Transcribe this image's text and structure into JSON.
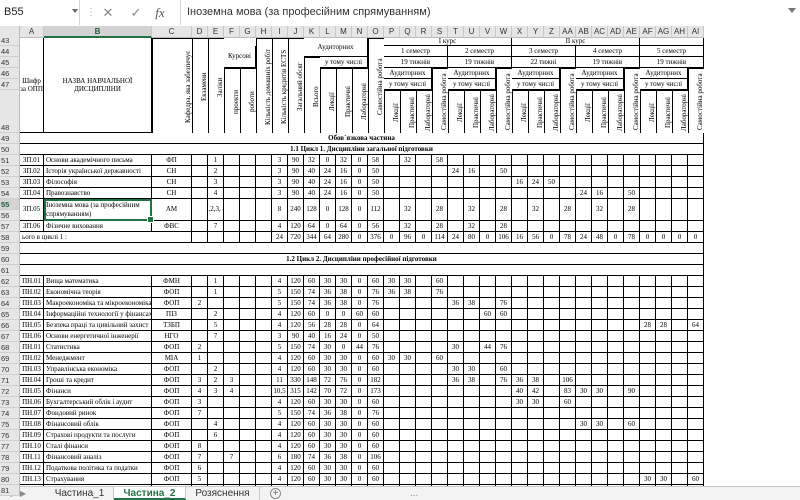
{
  "formula_bar": {
    "name_box": "B55",
    "cancel_icon": "close-icon",
    "confirm_icon": "check-icon",
    "fx_label": "fx",
    "content": "Іноземна мова (за професійним спрямуванням)"
  },
  "columns": [
    "A",
    "B",
    "C",
    "D",
    "E",
    "F",
    "G",
    "H",
    "I",
    "J",
    "K",
    "L",
    "M",
    "N",
    "O",
    "P",
    "Q",
    "R",
    "S",
    "T",
    "U",
    "V",
    "W",
    "X",
    "Y",
    "Z",
    "AA",
    "AB",
    "AC",
    "AD",
    "AE",
    "AF",
    "AG",
    "AH",
    "AI"
  ],
  "selected_column": "B",
  "header_rows": [
    "43",
    "44",
    "45",
    "46",
    "47",
    "48"
  ],
  "rows": [
    "49",
    "50",
    "51",
    "52",
    "53",
    "54",
    "55",
    "56",
    "57",
    "58",
    "59",
    "60",
    "61",
    "62",
    "63",
    "64",
    "65",
    "66",
    "67",
    "68",
    "69",
    "70",
    "71",
    "72",
    "73",
    "74",
    "75",
    "76",
    "77",
    "78",
    "79",
    "80",
    "81",
    "82",
    "83",
    "84",
    "85"
  ],
  "selected_row": "55",
  "table_header": {
    "code": "Шифр за ОПП",
    "name": "НАЗВА НАВЧАЛЬНОЇ ДИСЦИПЛІНИ",
    "dept": "Кафедра, яка забезпечує",
    "exams": "Екзамени",
    "credits_pass": "Заліки",
    "course_group": "Курсові",
    "projects": "проекти",
    "works": "роботи",
    "ind_works": "Кількість домашніх робіт",
    "ects": "Кількість кредитів ECTS",
    "total": "Загальний обсяг",
    "class_group": "Аудиторних",
    "incl": "у тому числі",
    "all": "Всього",
    "lect": "Лекції",
    "pract": "Практичні",
    "lab": "Лабораторні",
    "self": "Самостійна робота",
    "course1": "І курс",
    "course2": "ІІ курс",
    "sem1": "1 семестр",
    "sem2": "2 семестр",
    "sem3": "3 семестр",
    "sem4": "4 семестр",
    "sem5": "5 семестр",
    "weeks19": "19 тижнів",
    "weeks22": "22 тижні",
    "aud": "Аудиторних",
    "incl2": "у тому числі"
  },
  "sections": {
    "obligatory": "Обов`язкова частина",
    "cycle1": "1.1 Цикл 1. Дисципліни загальної підготовки",
    "cycle2": "1.2 Цикл 2. Дисципліни професійної підготовки"
  },
  "cycle1_rows": [
    {
      "code": "ЗП.01",
      "name": "Основи академічного письма",
      "dept": "ФП",
      "d": "",
      "e": "1",
      "f": "",
      "g": "",
      "h": "",
      "i": "3",
      "j": "90",
      "k": "32",
      "l": "0",
      "m": "32",
      "n": "0",
      "o": "58",
      "p": "",
      "q": "32",
      "r": "",
      "s": "58",
      "t": "",
      "u": "",
      "v": "",
      "w": "",
      "x": "",
      "y": "",
      "z": "",
      "aa": "",
      "ab": "",
      "ac": "",
      "ad": "",
      "ae": "",
      "af": "",
      "ag": "",
      "ah": "",
      "ai": ""
    },
    {
      "code": "ЗП.02",
      "name": "Історія української державності",
      "dept": "СН",
      "d": "",
      "e": "2",
      "f": "",
      "g": "",
      "h": "",
      "i": "3",
      "j": "90",
      "k": "40",
      "l": "24",
      "m": "16",
      "n": "0",
      "o": "50",
      "p": "",
      "q": "",
      "r": "",
      "s": "",
      "t": "24",
      "u": "16",
      "v": "",
      "w": "50",
      "x": "",
      "y": "",
      "z": "",
      "aa": "",
      "ab": "",
      "ac": "",
      "ad": "",
      "ae": "",
      "af": "",
      "ag": "",
      "ah": "",
      "ai": ""
    },
    {
      "code": "ЗП.03",
      "name": "Філософія",
      "dept": "СН",
      "d": "",
      "e": "3",
      "f": "",
      "g": "",
      "h": "",
      "i": "3",
      "j": "90",
      "k": "40",
      "l": "24",
      "m": "16",
      "n": "0",
      "o": "50",
      "p": "",
      "q": "",
      "r": "",
      "s": "",
      "t": "",
      "u": "",
      "v": "",
      "w": "",
      "x": "16",
      "y": "24",
      "z": "50",
      "aa": "",
      "ab": "",
      "ac": "",
      "ad": "",
      "ae": "",
      "af": "",
      "ag": "",
      "ah": "",
      "ai": ""
    },
    {
      "code": "ЗП.04",
      "name": "Правознавство",
      "dept": "СН",
      "d": "",
      "e": "4",
      "f": "",
      "g": "",
      "h": "",
      "i": "3",
      "j": "90",
      "k": "40",
      "l": "24",
      "m": "16",
      "n": "0",
      "o": "50",
      "p": "",
      "q": "",
      "r": "",
      "s": "",
      "t": "",
      "u": "",
      "v": "",
      "w": "",
      "x": "",
      "y": "",
      "z": "",
      "aa": "",
      "ab": "24",
      "ac": "16",
      "ad": "",
      "ae": "50",
      "af": "",
      "ag": "",
      "ah": "",
      "ai": ""
    },
    {
      "code": "ЗП.05",
      "name": "Іноземна мова (за професійним спрямуванням)",
      "dept": "АМ",
      "d": "",
      "e": "1,2,3,\n4",
      "f": "",
      "g": "",
      "h": "",
      "i": "8",
      "j": "240",
      "k": "128",
      "l": "0",
      "m": "128",
      "n": "0",
      "o": "112",
      "p": "",
      "q": "32",
      "r": "",
      "s": "28",
      "t": "",
      "u": "32",
      "v": "",
      "w": "28",
      "x": "",
      "y": "32",
      "z": "",
      "aa": "28",
      "ab": "",
      "ac": "32",
      "ad": "",
      "ae": "28",
      "af": "",
      "ag": "",
      "ah": "",
      "ai": ""
    },
    {
      "code": "ЗП.06",
      "name": "Фізичне виховання",
      "dept": "ФВС",
      "d": "",
      "e": "7",
      "f": "",
      "g": "",
      "h": "",
      "i": "4",
      "j": "120",
      "k": "64",
      "l": "0",
      "m": "64",
      "n": "0",
      "o": "56",
      "p": "",
      "q": "32",
      "r": "",
      "s": "28",
      "t": "",
      "u": "32",
      "v": "",
      "w": "28",
      "x": "",
      "y": "",
      "z": "",
      "aa": "",
      "ab": "",
      "ac": "",
      "ad": "",
      "ae": "",
      "af": "",
      "ag": "",
      "ah": "",
      "ai": ""
    }
  ],
  "cycle1_total": {
    "label": "ього в циклі 1 :",
    "i": "24",
    "j": "720",
    "k": "344",
    "l": "64",
    "m": "280",
    "n": "0",
    "o": "376",
    "p": "0",
    "q": "96",
    "r": "0",
    "s": "114",
    "t": "24",
    "u": "80",
    "v": "0",
    "w": "106",
    "x": "16",
    "y": "56",
    "z": "0",
    "aa": "78",
    "ab": "24",
    "ac": "48",
    "ad": "0",
    "ae": "78",
    "af": "0",
    "ag": "0",
    "ah": "0",
    "ai": "0"
  },
  "cycle2_rows": [
    {
      "code": "ПН.01",
      "name": "Вища математика",
      "dept": "ФМН",
      "d": "",
      "e": "1",
      "f": "",
      "g": "",
      "h": "",
      "i": "4",
      "j": "120",
      "k": "60",
      "l": "30",
      "m": "30",
      "n": "0",
      "o": "60",
      "p": "30",
      "q": "30",
      "r": "",
      "s": "60",
      "t": "",
      "u": "",
      "v": "",
      "w": "",
      "x": "",
      "y": "",
      "z": "",
      "aa": "",
      "ab": "",
      "ac": "",
      "ad": "",
      "ae": "",
      "af": "",
      "ag": "",
      "ah": "",
      "ai": ""
    },
    {
      "code": "ПН.02",
      "name": "Економічна теорія",
      "dept": "ФОП",
      "d": "",
      "e": "1",
      "f": "",
      "g": "",
      "h": "",
      "i": "5",
      "j": "150",
      "k": "74",
      "l": "36",
      "m": "38",
      "n": "0",
      "o": "76",
      "p": "36",
      "q": "38",
      "r": "",
      "s": "76",
      "t": "",
      "u": "",
      "v": "",
      "w": "",
      "x": "",
      "y": "",
      "z": "",
      "aa": "",
      "ab": "",
      "ac": "",
      "ad": "",
      "ae": "",
      "af": "",
      "ag": "",
      "ah": "",
      "ai": ""
    },
    {
      "code": "ПН.03",
      "name": "Макроекономіка та мікроекономіка",
      "dept": "ФОП",
      "d": "2",
      "e": "",
      "f": "",
      "g": "",
      "h": "",
      "i": "5",
      "j": "150",
      "k": "74",
      "l": "36",
      "m": "38",
      "n": "0",
      "o": "76",
      "p": "",
      "q": "",
      "r": "",
      "s": "",
      "t": "36",
      "u": "38",
      "v": "",
      "w": "76",
      "x": "",
      "y": "",
      "z": "",
      "aa": "",
      "ab": "",
      "ac": "",
      "ad": "",
      "ae": "",
      "af": "",
      "ag": "",
      "ah": "",
      "ai": ""
    },
    {
      "code": "ПН.04",
      "name": "Інформаційні технології у фінансах",
      "dept": "ПІЗ",
      "d": "",
      "e": "2",
      "f": "",
      "g": "",
      "h": "",
      "i": "4",
      "j": "120",
      "k": "60",
      "l": "0",
      "m": "0",
      "n": "60",
      "o": "60",
      "p": "",
      "q": "",
      "r": "",
      "s": "",
      "t": "",
      "u": "",
      "v": "60",
      "w": "60",
      "x": "",
      "y": "",
      "z": "",
      "aa": "",
      "ab": "",
      "ac": "",
      "ad": "",
      "ae": "",
      "af": "",
      "ag": "",
      "ah": "",
      "ai": ""
    },
    {
      "code": "ПН.05",
      "name": "Безпека праці та цивільний захист",
      "dept": "ТЗБП",
      "d": "",
      "e": "5",
      "f": "",
      "g": "",
      "h": "",
      "i": "4",
      "j": "120",
      "k": "56",
      "l": "28",
      "m": "28",
      "n": "0",
      "o": "64",
      "p": "",
      "q": "",
      "r": "",
      "s": "",
      "t": "",
      "u": "",
      "v": "",
      "w": "",
      "x": "",
      "y": "",
      "z": "",
      "aa": "",
      "ab": "",
      "ac": "",
      "ad": "",
      "ae": "",
      "af": "28",
      "ag": "28",
      "ah": "",
      "ai": "64"
    },
    {
      "code": "ПН.06",
      "name": "Основи енергетичної інженерії",
      "dept": "НГО",
      "d": "",
      "e": "7",
      "f": "",
      "g": "",
      "h": "",
      "i": "3",
      "j": "90",
      "k": "40",
      "l": "16",
      "m": "24",
      "n": "0",
      "o": "50",
      "p": "",
      "q": "",
      "r": "",
      "s": "",
      "t": "",
      "u": "",
      "v": "",
      "w": "",
      "x": "",
      "y": "",
      "z": "",
      "aa": "",
      "ab": "",
      "ac": "",
      "ad": "",
      "ae": "",
      "af": "",
      "ag": "",
      "ah": "",
      "ai": ""
    },
    {
      "code": "ПН.01",
      "name": "Статистика",
      "dept": "ФОП",
      "d": "2",
      "e": "",
      "f": "",
      "g": "",
      "h": "",
      "i": "5",
      "j": "150",
      "k": "74",
      "l": "30",
      "m": "0",
      "n": "44",
      "o": "76",
      "p": "",
      "q": "",
      "r": "",
      "s": "",
      "t": "30",
      "u": "",
      "v": "44",
      "w": "76",
      "x": "",
      "y": "",
      "z": "",
      "aa": "",
      "ab": "",
      "ac": "",
      "ad": "",
      "ae": "",
      "af": "",
      "ag": "",
      "ah": "",
      "ai": ""
    },
    {
      "code": "ПН.02",
      "name": "Менеджмент",
      "dept": "МІА",
      "d": "1",
      "e": "",
      "f": "",
      "g": "",
      "h": "",
      "i": "4",
      "j": "120",
      "k": "60",
      "l": "30",
      "m": "30",
      "n": "0",
      "o": "60",
      "p": "30",
      "q": "30",
      "r": "",
      "s": "60",
      "t": "",
      "u": "",
      "v": "",
      "w": "",
      "x": "",
      "y": "",
      "z": "",
      "aa": "",
      "ab": "",
      "ac": "",
      "ad": "",
      "ae": "",
      "af": "",
      "ag": "",
      "ah": "",
      "ai": ""
    },
    {
      "code": "ПН.03",
      "name": "Управлінська економіка",
      "dept": "ФОП",
      "d": "",
      "e": "2",
      "f": "",
      "g": "",
      "h": "",
      "i": "4",
      "j": "120",
      "k": "60",
      "l": "30",
      "m": "30",
      "n": "0",
      "o": "60",
      "p": "",
      "q": "",
      "r": "",
      "s": "",
      "t": "30",
      "u": "30",
      "v": "",
      "w": "60",
      "x": "",
      "y": "",
      "z": "",
      "aa": "",
      "ab": "",
      "ac": "",
      "ad": "",
      "ae": "",
      "af": "",
      "ag": "",
      "ah": "",
      "ai": ""
    },
    {
      "code": "ПН.04",
      "name": "Гроші та кредит",
      "dept": "ФОП",
      "d": "3",
      "e": "2",
      "f": "3",
      "g": "",
      "h": "",
      "i": "11",
      "j": "330",
      "k": "148",
      "l": "72",
      "m": "76",
      "n": "0",
      "o": "182",
      "p": "",
      "q": "",
      "r": "",
      "s": "",
      "t": "36",
      "u": "38",
      "v": "",
      "w": "76",
      "x": "36",
      "y": "38",
      "z": "",
      "aa": "106",
      "ab": "",
      "ac": "",
      "ad": "",
      "ae": "",
      "af": "",
      "ag": "",
      "ah": "",
      "ai": ""
    },
    {
      "code": "ПН.05",
      "name": "Фінанси",
      "dept": "ФОП",
      "d": "4",
      "e": "3",
      "f": "4",
      "g": "",
      "h": "",
      "i": "10,5",
      "j": "315",
      "k": "142",
      "l": "70",
      "m": "72",
      "n": "0",
      "o": "173",
      "p": "",
      "q": "",
      "r": "",
      "s": "",
      "t": "",
      "u": "",
      "v": "",
      "w": "",
      "x": "40",
      "y": "42",
      "z": "",
      "aa": "83",
      "ab": "30",
      "ac": "30",
      "ad": "",
      "ae": "90",
      "af": "",
      "ag": "",
      "ah": "",
      "ai": ""
    },
    {
      "code": "ПН.06",
      "name": "Бухгалтерський облік і аудит",
      "dept": "ФОП",
      "d": "3",
      "e": "",
      "f": "",
      "g": "",
      "h": "",
      "i": "4",
      "j": "120",
      "k": "60",
      "l": "30",
      "m": "30",
      "n": "0",
      "o": "60",
      "p": "",
      "q": "",
      "r": "",
      "s": "",
      "t": "",
      "u": "",
      "v": "",
      "w": "",
      "x": "30",
      "y": "30",
      "z": "",
      "aa": "60",
      "ab": "",
      "ac": "",
      "ad": "",
      "ae": "",
      "af": "",
      "ag": "",
      "ah": "",
      "ai": ""
    },
    {
      "code": "ПН.07",
      "name": "Фондовий ринок",
      "dept": "ФОП",
      "d": "7",
      "e": "",
      "f": "",
      "g": "",
      "h": "",
      "i": "5",
      "j": "150",
      "k": "74",
      "l": "36",
      "m": "38",
      "n": "0",
      "o": "76",
      "p": "",
      "q": "",
      "r": "",
      "s": "",
      "t": "",
      "u": "",
      "v": "",
      "w": "",
      "x": "",
      "y": "",
      "z": "",
      "aa": "",
      "ab": "",
      "ac": "",
      "ad": "",
      "ae": "",
      "af": "",
      "ag": "",
      "ah": "",
      "ai": ""
    },
    {
      "code": "ПН.08",
      "name": "Фінансовий облік",
      "dept": "ФОП",
      "d": "",
      "e": "4",
      "f": "",
      "g": "",
      "h": "",
      "i": "4",
      "j": "120",
      "k": "60",
      "l": "30",
      "m": "30",
      "n": "0",
      "o": "60",
      "p": "",
      "q": "",
      "r": "",
      "s": "",
      "t": "",
      "u": "",
      "v": "",
      "w": "",
      "x": "",
      "y": "",
      "z": "",
      "aa": "",
      "ab": "30",
      "ac": "30",
      "ad": "",
      "ae": "60",
      "af": "",
      "ag": "",
      "ah": "",
      "ai": ""
    },
    {
      "code": "ПН.09",
      "name": "Страхові продукти та послуги",
      "dept": "ФОП",
      "d": "",
      "e": "6",
      "f": "",
      "g": "",
      "h": "",
      "i": "4",
      "j": "120",
      "k": "60",
      "l": "30",
      "m": "30",
      "n": "0",
      "o": "60",
      "p": "",
      "q": "",
      "r": "",
      "s": "",
      "t": "",
      "u": "",
      "v": "",
      "w": "",
      "x": "",
      "y": "",
      "z": "",
      "aa": "",
      "ab": "",
      "ac": "",
      "ad": "",
      "ae": "",
      "af": "",
      "ag": "",
      "ah": "",
      "ai": ""
    },
    {
      "code": "ПН.10",
      "name": "Сталі фінанси",
      "dept": "ФОП",
      "d": "8",
      "e": "",
      "f": "",
      "g": "",
      "h": "",
      "i": "4",
      "j": "120",
      "k": "60",
      "l": "30",
      "m": "30",
      "n": "0",
      "o": "60",
      "p": "",
      "q": "",
      "r": "",
      "s": "",
      "t": "",
      "u": "",
      "v": "",
      "w": "",
      "x": "",
      "y": "",
      "z": "",
      "aa": "",
      "ab": "",
      "ac": "",
      "ad": "",
      "ae": "",
      "af": "",
      "ag": "",
      "ah": "",
      "ai": ""
    },
    {
      "code": "ПН.11",
      "name": "Фінансовий аналіз",
      "dept": "ФОП",
      "d": "7",
      "e": "",
      "f": "7",
      "g": "",
      "h": "",
      "i": "6",
      "j": "180",
      "k": "74",
      "l": "36",
      "m": "38",
      "n": "0",
      "o": "106",
      "p": "",
      "q": "",
      "r": "",
      "s": "",
      "t": "",
      "u": "",
      "v": "",
      "w": "",
      "x": "",
      "y": "",
      "z": "",
      "aa": "",
      "ab": "",
      "ac": "",
      "ad": "",
      "ae": "",
      "af": "",
      "ag": "",
      "ah": "",
      "ai": ""
    },
    {
      "code": "ПН.12",
      "name": "Податкова політика та податки",
      "dept": "ФОП",
      "d": "6",
      "e": "",
      "f": "",
      "g": "",
      "h": "",
      "i": "4",
      "j": "120",
      "k": "60",
      "l": "30",
      "m": "30",
      "n": "0",
      "o": "60",
      "p": "",
      "q": "",
      "r": "",
      "s": "",
      "t": "",
      "u": "",
      "v": "",
      "w": "",
      "x": "",
      "y": "",
      "z": "",
      "aa": "",
      "ab": "",
      "ac": "",
      "ad": "",
      "ae": "",
      "af": "",
      "ag": "",
      "ah": "",
      "ai": ""
    },
    {
      "code": "ПН.13",
      "name": "Страхування",
      "dept": "ФОП",
      "d": "5",
      "e": "",
      "f": "",
      "g": "",
      "h": "",
      "i": "4",
      "j": "120",
      "k": "60",
      "l": "30",
      "m": "30",
      "n": "0",
      "o": "60",
      "p": "",
      "q": "",
      "r": "",
      "s": "",
      "t": "",
      "u": "",
      "v": "",
      "w": "",
      "x": "",
      "y": "",
      "z": "",
      "aa": "",
      "ab": "",
      "ac": "",
      "ad": "",
      "ae": "",
      "af": "30",
      "ag": "30",
      "ah": "",
      "ai": "60"
    },
    {
      "code": "ПН.14",
      "name": "Фінанси суб'єктів господарювання",
      "dept": "ФОП",
      "d": "5",
      "e": "",
      "f": "",
      "g": "",
      "h": "",
      "i": "4",
      "j": "120",
      "k": "60",
      "l": "30",
      "m": "30",
      "n": "0",
      "o": "60",
      "p": "",
      "q": "",
      "r": "",
      "s": "",
      "t": "",
      "u": "",
      "v": "",
      "w": "",
      "x": "",
      "y": "",
      "z": "",
      "aa": "",
      "ab": "",
      "ac": "",
      "ad": "",
      "ae": "",
      "af": "30",
      "ag": "30",
      "ah": "",
      "ai": "60"
    }
  ],
  "sheet_tabs": {
    "tabs": [
      "Частина_1",
      "Частина_2",
      "Розяснення"
    ],
    "active": "Частина_2",
    "add_icon": "plus-icon",
    "more": "..."
  }
}
